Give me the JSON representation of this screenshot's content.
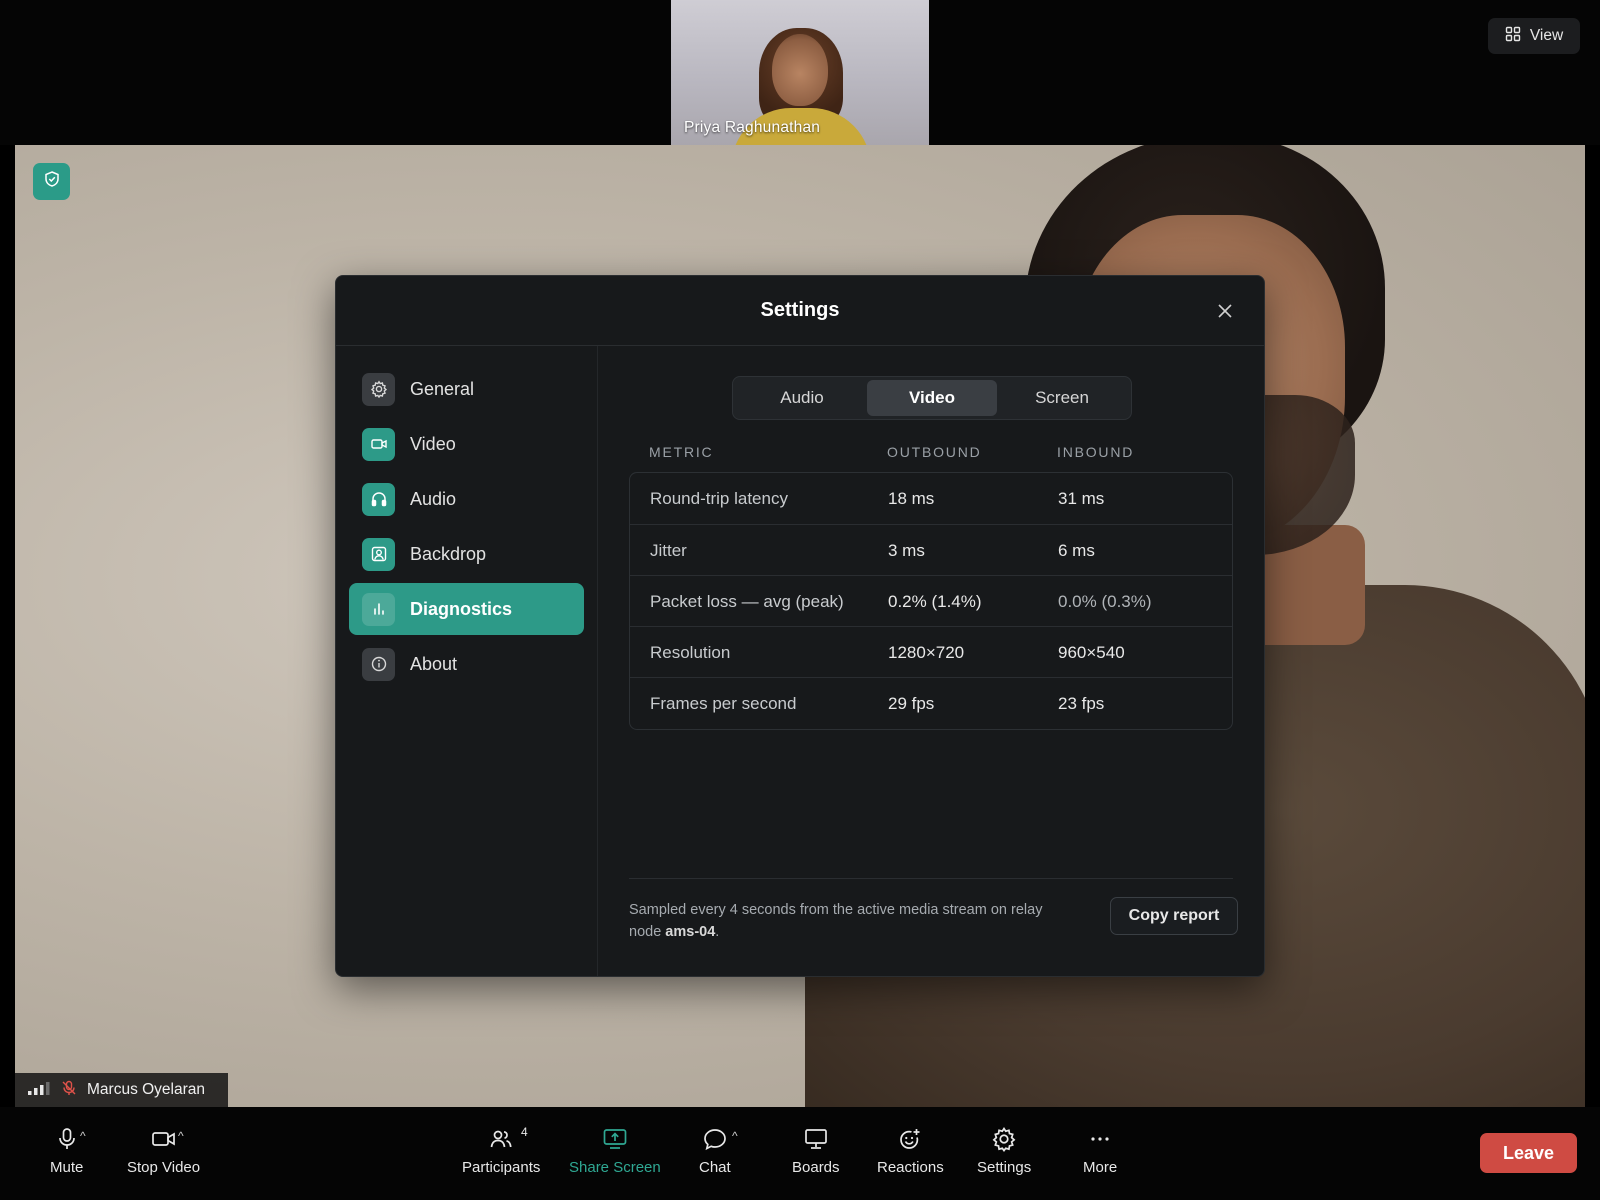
{
  "top": {
    "thumbnail_name": "Priya Raghunathan",
    "view_label": "View"
  },
  "main_video": {
    "participant_name": "Marcus Oyelaran"
  },
  "settings": {
    "title": "Settings",
    "nav": [
      {
        "label": "General",
        "icon": "gear-icon"
      },
      {
        "label": "Video",
        "icon": "camera-icon"
      },
      {
        "label": "Audio",
        "icon": "headphones-icon"
      },
      {
        "label": "Backdrop",
        "icon": "portrait-icon"
      },
      {
        "label": "Diagnostics",
        "icon": "bar-chart-icon",
        "active": true
      },
      {
        "label": "About",
        "icon": "info-icon"
      }
    ],
    "tabs": [
      {
        "label": "Audio"
      },
      {
        "label": "Video",
        "active": true
      },
      {
        "label": "Screen"
      }
    ],
    "table": {
      "headers": [
        "METRIC",
        "OUTBOUND",
        "INBOUND"
      ],
      "rows": [
        {
          "metric": "Round-trip latency",
          "outbound": "18 ms",
          "inbound": "31 ms"
        },
        {
          "metric": "Jitter",
          "outbound": "3 ms",
          "inbound": "6 ms"
        },
        {
          "metric": "Packet loss — avg (peak)",
          "outbound": "0.2% (1.4%)",
          "inbound": "0.0% (0.3%)"
        },
        {
          "metric": "Resolution",
          "outbound": "1280×720",
          "inbound": "960×540"
        },
        {
          "metric": "Frames per second",
          "outbound": "29 fps",
          "inbound": "23 fps"
        }
      ]
    },
    "footer": {
      "note_prefix": "Sampled every 4 seconds from the active media stream on relay node ",
      "relay_node": "ams-04",
      "note_suffix": ".",
      "copy_label": "Copy report"
    }
  },
  "toolbar": {
    "mute": "Mute",
    "stop_video": "Stop Video",
    "participants": "Participants",
    "participants_count": "4",
    "share_screen": "Share Screen",
    "chat": "Chat",
    "boards": "Boards",
    "reactions": "Reactions",
    "settings": "Settings",
    "more": "More",
    "leave": "Leave"
  },
  "colors": {
    "accent": "#2d9a88",
    "leave": "#cf4b43",
    "modal_bg": "#17191b"
  }
}
